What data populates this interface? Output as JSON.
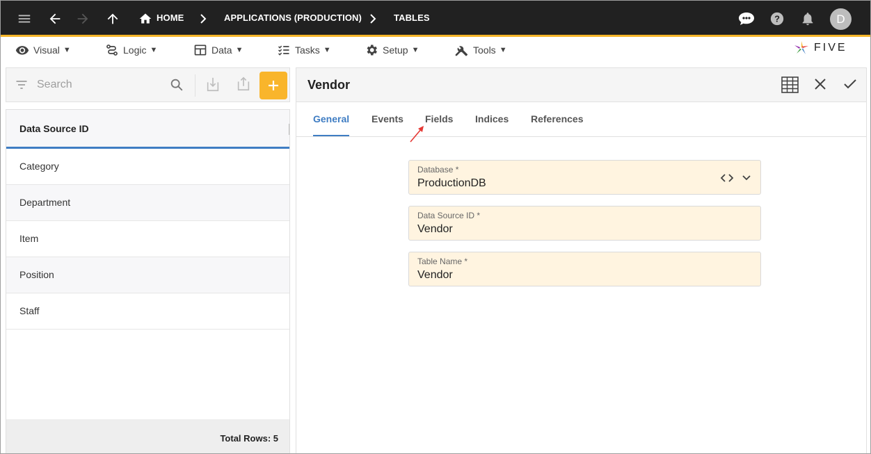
{
  "topbar": {
    "breadcrumbs": [
      {
        "label": "HOME",
        "icon": "home-icon"
      },
      {
        "label": "APPLICATIONS (PRODUCTION)"
      },
      {
        "label": "TABLES"
      }
    ],
    "avatar_initial": "D",
    "bar_color": "#212121",
    "accent_color": "#f5b528"
  },
  "menubar": {
    "items": [
      {
        "label": "Visual",
        "icon": "eye-icon"
      },
      {
        "label": "Logic",
        "icon": "logic-flow-icon"
      },
      {
        "label": "Data",
        "icon": "table-grid-icon"
      },
      {
        "label": "Tasks",
        "icon": "checklist-icon"
      },
      {
        "label": "Setup",
        "icon": "gear-icon"
      },
      {
        "label": "Tools",
        "icon": "tools-icon"
      }
    ],
    "logo_text": "FIVE"
  },
  "left_panel": {
    "search_placeholder": "Search",
    "column_header": "Data Source ID",
    "rows": [
      "Category",
      "Department",
      "Item",
      "Position",
      "Staff"
    ],
    "footer": "Total Rows: 5",
    "add_button_color": "#f9b52b"
  },
  "right_panel": {
    "title": "Vendor",
    "tabs": [
      "General",
      "Events",
      "Fields",
      "Indices",
      "References"
    ],
    "active_tab": "General",
    "active_color": "#3f7dc3",
    "fields": [
      {
        "label": "Database *",
        "value": "ProductionDB"
      },
      {
        "label": "Data Source ID *",
        "value": "Vendor"
      },
      {
        "label": "Table Name *",
        "value": "Vendor"
      }
    ]
  }
}
